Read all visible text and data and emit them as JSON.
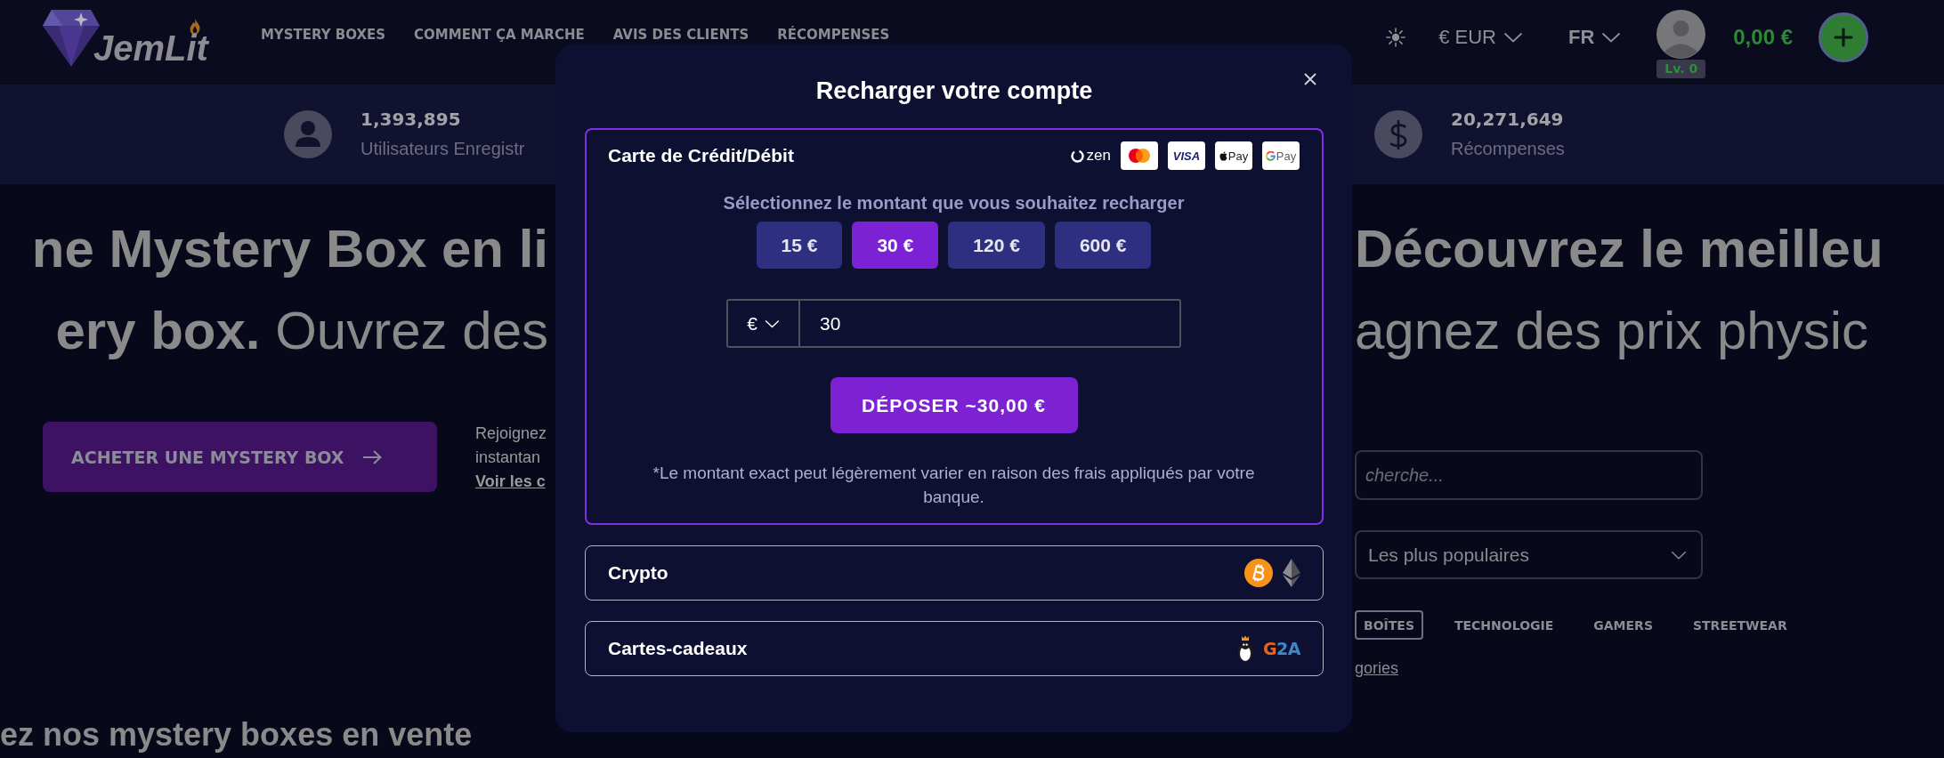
{
  "header": {
    "logo": {
      "text": "JemLit"
    },
    "nav": [
      {
        "label": "MYSTERY BOXES"
      },
      {
        "label": "COMMENT ÇA MARCHE"
      },
      {
        "label": "AVIS DES CLIENTS"
      },
      {
        "label": "RÉCOMPENSES"
      }
    ],
    "currency": {
      "label": "€ EUR"
    },
    "language": {
      "label": "FR"
    },
    "user": {
      "level": "Lv. 0"
    },
    "balance": "0,00 €"
  },
  "stats": [
    {
      "kind": "users",
      "value": "1,393,895",
      "label": "Utilisateurs Enregistr"
    },
    {
      "kind": "rewards",
      "value": "20,271,649",
      "label": "Récompenses"
    }
  ],
  "hero": {
    "title_left": [
      {
        "kind": "bold",
        "text": "ne Mystery Box en li"
      },
      {
        "kind": "plain",
        "text": "**ery box.** Ouvrez des"
      }
    ],
    "title_right": [
      {
        "kind": "bold",
        "text": "Découvrez le meilleu"
      },
      {
        "kind": "plain",
        "text": "agnez des prix physic"
      }
    ],
    "cta_button": "ACHETER UNE MYSTERY BOX",
    "side_text": [
      "Rejoignez",
      "instantan"
    ],
    "side_link": "Voir les c",
    "section_heading": "ez nos mystery boxes en vente"
  },
  "filters": {
    "search": {
      "placeholder": "cherche..."
    },
    "sort": {
      "value": "Les plus populaires"
    },
    "categories": [
      {
        "label": "BOÎTES",
        "selected": true
      },
      {
        "label": "TECHNOLOGIE",
        "selected": false
      },
      {
        "label": "GAMERS",
        "selected": false
      },
      {
        "label": "STREETWEAR",
        "selected": false
      }
    ],
    "all_link": "gories"
  },
  "modal": {
    "title": "Recharger votre compte",
    "methods": [
      {
        "label": "Carte de Crédit/Débit",
        "expanded": true,
        "logos": [
          {
            "kind": "zen",
            "text": "zen"
          },
          {
            "kind": "mastercard"
          },
          {
            "kind": "visa",
            "text": "VISA"
          },
          {
            "kind": "applepay",
            "text": "Pay"
          },
          {
            "kind": "googlepay",
            "text": "Pay"
          }
        ],
        "form": {
          "prompt": "Sélectionnez le montant que vous souhaitez recharger",
          "amounts": [
            {
              "label": "15 €",
              "selected": false
            },
            {
              "label": "30 €",
              "selected": true
            },
            {
              "label": "120 €",
              "selected": false
            },
            {
              "label": "600 €",
              "selected": false
            }
          ],
          "currency": "€",
          "amount": {
            "value": "30"
          },
          "deposit_button": "DÉPOSER ~30,00 €",
          "note": "*Le montant exact peut légèrement varier en raison des frais appliqués par votre banque."
        }
      },
      {
        "label": "Crypto",
        "expanded": false,
        "logos": [
          {
            "kind": "bitcoin"
          },
          {
            "kind": "ethereum"
          }
        ]
      },
      {
        "label": "Cartes-cadeaux",
        "expanded": false,
        "logos": [
          {
            "kind": "penguin"
          },
          {
            "kind": "g2a",
            "text": "G2A"
          }
        ]
      }
    ]
  }
}
